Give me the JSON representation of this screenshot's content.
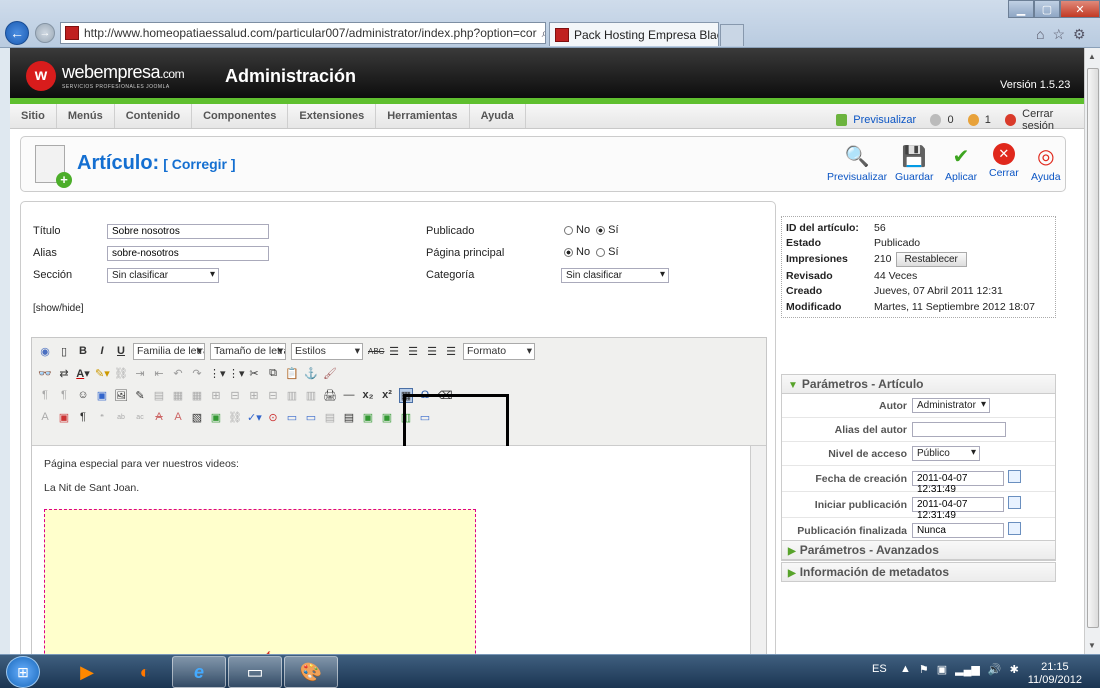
{
  "browser": {
    "url": "http://www.homeopatiaessalud.com/particular007/administrator/index.php?option=cor",
    "tab_title": "Pack Hosting Empresa Blac...",
    "tab_close": "×"
  },
  "header": {
    "logo_glyph": "w",
    "logo_name": "webempresa",
    "logo_tld": ".com",
    "logo_tagline": "SERVICIOS PROFESIONALES JOOMLA",
    "title": "Administración",
    "version": "Versión 1.5.23"
  },
  "menu": {
    "items": [
      "Sitio",
      "Menús",
      "Contenido",
      "Componentes",
      "Extensiones",
      "Herramientas",
      "Ayuda"
    ],
    "preview": "Previsualizar",
    "count_messages": "0",
    "count_users": "1",
    "logout": "Cerrar sesión"
  },
  "toolbar": {
    "title": "Artículo:",
    "subtitle": "[ Corregir ]",
    "buttons": {
      "preview": "Previsualizar",
      "save": "Guardar",
      "apply": "Aplicar",
      "close": "Cerrar",
      "help": "Ayuda"
    }
  },
  "form": {
    "title_label": "Título",
    "title_value": "Sobre nosotros",
    "alias_label": "Alias",
    "alias_value": "sobre-nosotros",
    "section_label": "Sección",
    "section_value": "Sin clasificar",
    "published_label": "Publicado",
    "published_no": "No",
    "published_yes": "Sí",
    "frontpage_label": "Página principal",
    "frontpage_no": "No",
    "frontpage_yes": "Sí",
    "category_label": "Categoría",
    "category_value": "Sin clasificar",
    "show_hide": "[show/hide]"
  },
  "editor": {
    "font_family": "Familia de letra",
    "font_size": "Tamaño de letra",
    "styles": "Estilos",
    "format": "Formato",
    "line1": "Página especial para ver nuestros videos:",
    "line2": "La Nit de Sant Joan."
  },
  "info": {
    "id_label": "ID del artículo:",
    "id_value": "56",
    "state_label": "Estado",
    "state_value": "Publicado",
    "hits_label": "Impresiones",
    "hits_value": "210",
    "reset_button": "Restablecer",
    "revised_label": "Revisado",
    "revised_value": "44 Veces",
    "created_label": "Creado",
    "created_value": "Jueves, 07 Abril 2011 12:31",
    "modified_label": "Modificado",
    "modified_value": "Martes, 11 Septiembre 2012 18:07"
  },
  "params": {
    "header": "Parámetros - Artículo",
    "author_label": "Autor",
    "author_value": "Administrator",
    "alias_label": "Alias del autor",
    "alias_value": "",
    "access_label": "Nivel de acceso",
    "access_value": "Público",
    "created_label": "Fecha de creación",
    "created_value": "2011-04-07 12:31:49",
    "start_label": "Iniciar publicación",
    "start_value": "2011-04-07 12:31:49",
    "finish_label": "Publicación finalizada",
    "finish_value": "Nunca",
    "advanced_header": "Parámetros - Avanzados",
    "meta_header": "Información de metadatos"
  },
  "taskbar": {
    "lang": "ES",
    "time": "21:15",
    "date": "11/09/2012"
  }
}
